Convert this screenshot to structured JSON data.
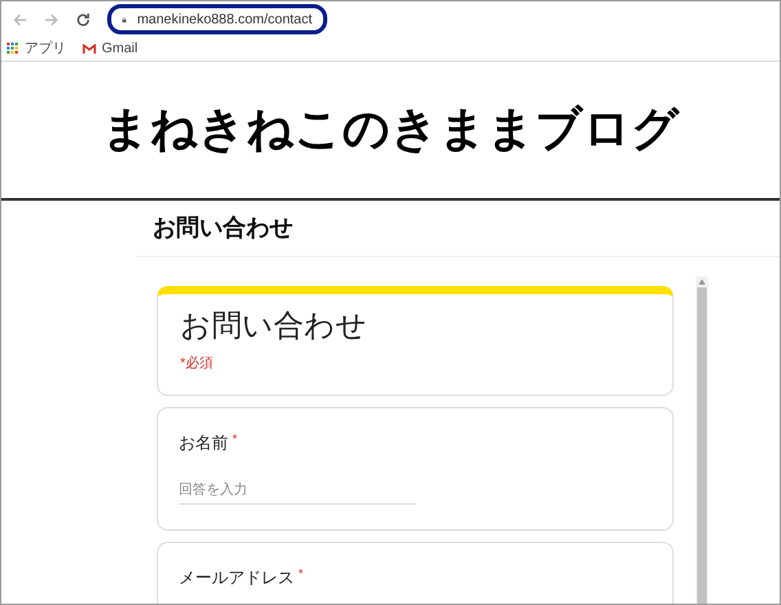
{
  "browser": {
    "url": "manekineko888.com/contact",
    "bookmarks": [
      {
        "kind": "apps",
        "label": "アプリ"
      },
      {
        "kind": "gmail",
        "label": "Gmail"
      }
    ]
  },
  "blog_title": "まねきねこのきままブログ",
  "page_heading": "お問い合わせ",
  "form": {
    "title": "お問い合わせ",
    "required_note": "*必須",
    "fields": [
      {
        "label": "お名前",
        "required_mark": "*",
        "placeholder": "回答を入力"
      },
      {
        "label": "メールアドレス",
        "required_mark": "*"
      }
    ]
  }
}
